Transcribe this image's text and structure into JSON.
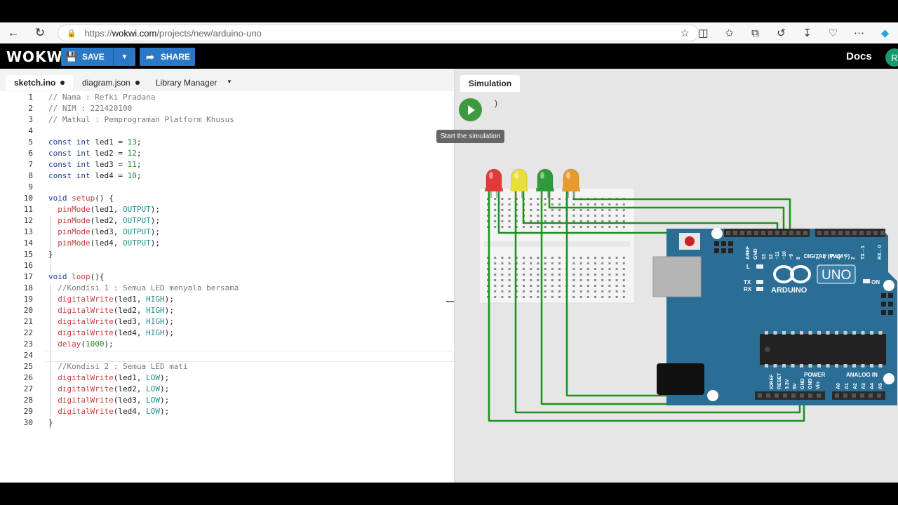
{
  "browser": {
    "url_prefix": "https://",
    "url_host": "wokwi.com",
    "url_path": "/projects/new/arduino-uno"
  },
  "header": {
    "logo": "WOKWi",
    "save_label": "SAVE",
    "share_label": "SHARE",
    "docs_label": "Docs",
    "avatar_initial": "R"
  },
  "editor": {
    "tabs": [
      {
        "label": "sketch.ino"
      },
      {
        "label": "diagram.json"
      },
      {
        "label": "Library Manager"
      }
    ],
    "lines": [
      "// Nama : Refki Pradana",
      "// NIM : 221420100",
      "// Matkul : Pemprograman Platform Khusus",
      "",
      "const int led1 = 13;",
      "const int led2 = 12;",
      "const int led3 = 11;",
      "const int led4 = 10;",
      "",
      "void setup() {",
      "  pinMode(led1, OUTPUT);",
      "  pinMode(led2, OUTPUT);",
      "  pinMode(led3, OUTPUT);",
      "  pinMode(led4, OUTPUT);",
      "}",
      "",
      "void loop(){",
      "  //Kondisi 1 : Semua LED menyala bersama",
      "  digitalWrite(led1, HIGH);",
      "  digitalWrite(led2, HIGH);",
      "  digitalWrite(led3, HIGH);",
      "  digitalWrite(led4, HIGH);",
      "  delay(1000);",
      "",
      "  //Kondisi 2 : Semua LED mati",
      "  digitalWrite(led1, LOW);",
      "  digitalWrite(led2, LOW);",
      "  digitalWrite(led3, LOW);",
      "  digitalWrite(led4, LOW);",
      "}"
    ]
  },
  "simulation": {
    "tab_label": "Simulation",
    "tooltip": "Start the simulation",
    "paren": ")",
    "leds": [
      {
        "color": "#e23a3a"
      },
      {
        "color": "#e8e03a"
      },
      {
        "color": "#2f9a3a"
      },
      {
        "color": "#e89a2a"
      }
    ],
    "wire_color": "#1f8f1f",
    "board": {
      "brand": "ARDUINO",
      "model": "UNO",
      "digital_label": "DIGITAL (PWM ~)",
      "power_label": "POWER",
      "analog_label": "ANALOG IN",
      "aref": "AREF",
      "gnd": "GND",
      "pins_digital": [
        "13",
        "12",
        "~11",
        "~10",
        "~9",
        "8",
        "7",
        "~6",
        "~5",
        "4",
        "~3",
        "2",
        "TX→1",
        "RX←0"
      ],
      "pins_power": [
        "IOREF",
        "RESET",
        "3.3V",
        "5V",
        "GND",
        "GND",
        "Vin"
      ],
      "pins_analog": [
        "A0",
        "A1",
        "A2",
        "A3",
        "A4",
        "A5"
      ],
      "on_label": "ON",
      "l_label": "L",
      "tx_label": "TX",
      "rx_label": "RX",
      "color": "#2a6e96"
    }
  }
}
